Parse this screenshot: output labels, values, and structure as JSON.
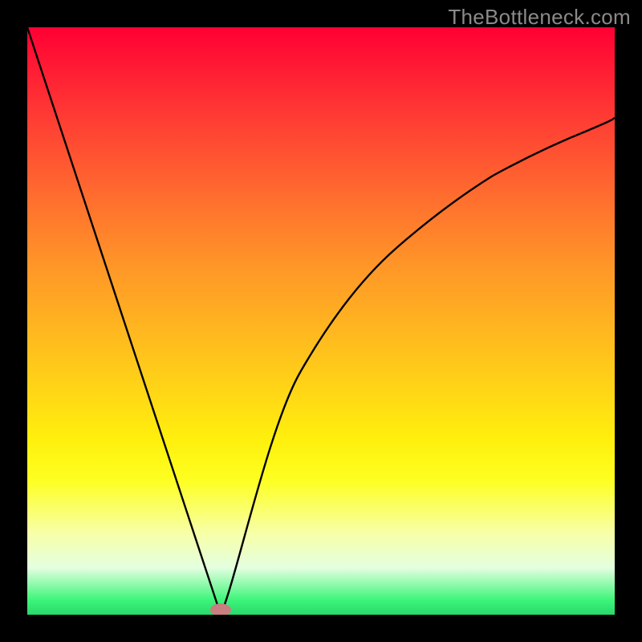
{
  "watermark": "TheBottleneck.com",
  "chart_data": {
    "type": "line",
    "title": "",
    "xlabel": "",
    "ylabel": "",
    "xlim": [
      0,
      1
    ],
    "ylim": [
      0,
      1
    ],
    "legend": false,
    "grid": false,
    "background": "rainbow-gradient-red-to-green-vertical",
    "series": [
      {
        "name": "bottleneck-curve",
        "x": [
          0.0,
          0.05,
          0.1,
          0.15,
          0.2,
          0.25,
          0.3,
          0.33,
          0.35,
          0.38,
          0.42,
          0.46,
          0.5,
          0.55,
          0.6,
          0.65,
          0.7,
          0.75,
          0.8,
          0.85,
          0.9,
          0.95,
          1.0
        ],
        "y": [
          1.0,
          0.848,
          0.697,
          0.545,
          0.394,
          0.242,
          0.091,
          0.0,
          0.065,
          0.185,
          0.316,
          0.413,
          0.491,
          0.566,
          0.625,
          0.674,
          0.714,
          0.749,
          0.779,
          0.805,
          0.828,
          0.848,
          0.866
        ]
      }
    ],
    "marker": {
      "name": "optimum-point",
      "x": 0.33,
      "y": 0.0,
      "shape": "ellipse",
      "color": "#c97e80"
    }
  }
}
